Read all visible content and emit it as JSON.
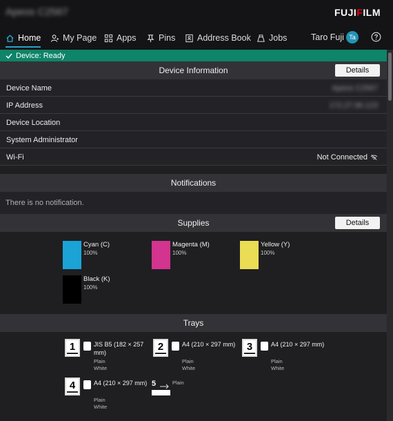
{
  "header": {
    "device_title": "Apeos C2567",
    "logo": "FUJIFILM"
  },
  "nav": {
    "home": "Home",
    "my_page": "My Page",
    "apps": "Apps",
    "pins": "Pins",
    "address_book": "Address Book",
    "jobs": "Jobs",
    "user_name": "Taro Fuji",
    "avatar_initials": "Ta"
  },
  "status": {
    "text": "Device: Ready",
    "color": "#0e8468"
  },
  "device_info": {
    "title": "Device Information",
    "details_label": "Details",
    "rows": [
      {
        "label": "Device Name",
        "value": "Apeos C2567"
      },
      {
        "label": "IP Address",
        "value": "172.27.96.123"
      },
      {
        "label": "Device Location",
        "value": ""
      },
      {
        "label": "System Administrator",
        "value": ""
      },
      {
        "label": "Wi-Fi",
        "value": "Not Connected"
      }
    ]
  },
  "notifications": {
    "title": "Notifications",
    "empty_text": "There is no notification."
  },
  "supplies": {
    "title": "Supplies",
    "details_label": "Details",
    "items": [
      {
        "name": "Cyan (C)",
        "level": "100%",
        "color": "#1ba3d6"
      },
      {
        "name": "Magenta (M)",
        "level": "100%",
        "color": "#d2348f"
      },
      {
        "name": "Yellow (Y)",
        "level": "100%",
        "color": "#ebdc55"
      },
      {
        "name": "Black (K)",
        "level": "100%",
        "color": "#000000"
      }
    ]
  },
  "trays": {
    "title": "Trays",
    "items": [
      {
        "number": "1",
        "size": "JIS B5 (182 × 257 mm)",
        "type": "Plain",
        "color": "White"
      },
      {
        "number": "2",
        "size": "A4 (210 × 297 mm)",
        "type": "Plain",
        "color": "White"
      },
      {
        "number": "3",
        "size": "A4 (210 × 297 mm)",
        "type": "Plain",
        "color": "White"
      },
      {
        "number": "4",
        "size": "A4 (210 × 297 mm)",
        "type": "Plain",
        "color": "White"
      }
    ],
    "bypass": {
      "number": "5",
      "type": "Plain"
    }
  }
}
